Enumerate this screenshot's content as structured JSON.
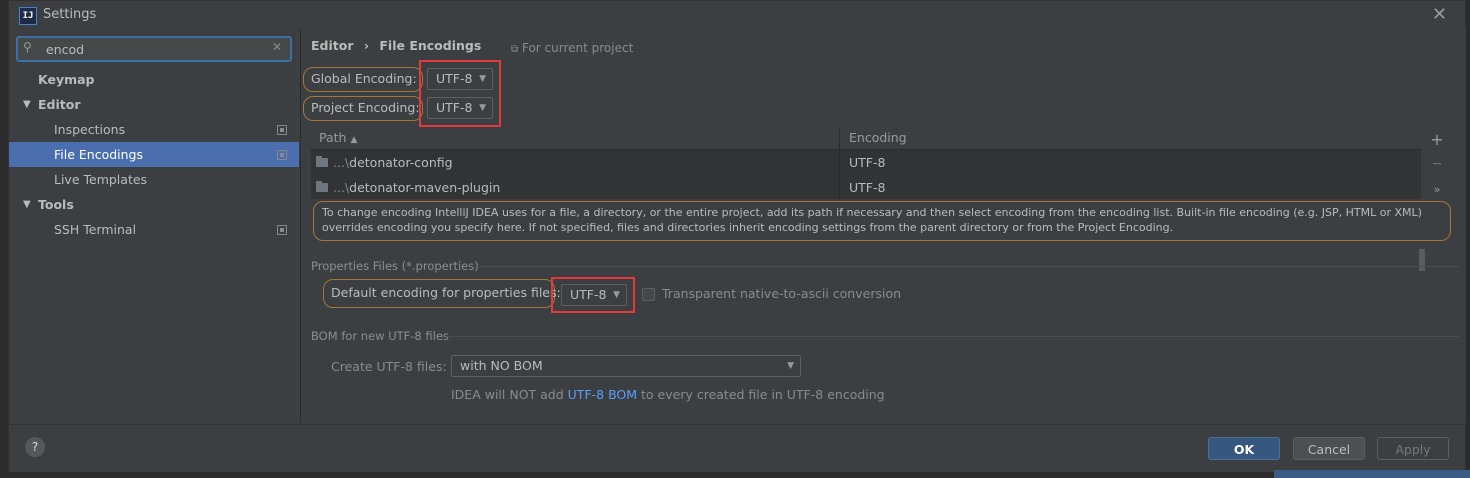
{
  "window": {
    "title": "Settings",
    "app_icon_text": "IJ"
  },
  "search": {
    "value": "encod"
  },
  "sidebar": {
    "items": [
      {
        "label": "Keymap"
      },
      {
        "label": "Editor"
      },
      {
        "label": "Inspections"
      },
      {
        "label": "File Encodings"
      },
      {
        "label": "Live Templates"
      },
      {
        "label": "Tools"
      },
      {
        "label": "SSH Terminal"
      }
    ]
  },
  "header": {
    "breadcrumb_parent": "Editor",
    "breadcrumb_sep": "›",
    "breadcrumb_current": "File Encodings",
    "scope": "For current project"
  },
  "global_encoding": {
    "label": "Global Encoding:",
    "value": "UTF-8"
  },
  "project_encoding": {
    "label": "Project Encoding:",
    "value": "UTF-8"
  },
  "table": {
    "col_path": "Path",
    "col_encoding": "Encoding",
    "rows": [
      {
        "prefix": "...\\",
        "name": "detonator-config",
        "encoding": "UTF-8"
      },
      {
        "prefix": "...\\",
        "name": "detonator-maven-plugin",
        "encoding": "UTF-8"
      }
    ],
    "add": "+",
    "remove": "—",
    "more": "»"
  },
  "info_text": "To change encoding IntelliJ IDEA uses for a file, a directory, or the entire project, add its path if necessary and then select encoding from the encoding list. Built-in file encoding (e.g. JSP, HTML or XML) overrides encoding you specify here. If not specified, files and directories inherit encoding settings from the parent directory or from the Project Encoding.",
  "properties": {
    "section": "Properties Files (*.properties)",
    "label": "Default encoding for properties files:",
    "value": "UTF-8",
    "checkbox_label": "Transparent native-to-ascii conversion",
    "checkbox_checked": false
  },
  "bom": {
    "section": "BOM for new UTF-8 files",
    "label": "Create UTF-8 files:",
    "value": "with NO BOM",
    "note_prefix": "IDEA will NOT add ",
    "note_link": "UTF-8 BOM",
    "note_suffix": " to every created file in UTF-8 encoding"
  },
  "buttons": {
    "help": "?",
    "ok": "OK",
    "cancel": "Cancel",
    "apply": "Apply"
  }
}
